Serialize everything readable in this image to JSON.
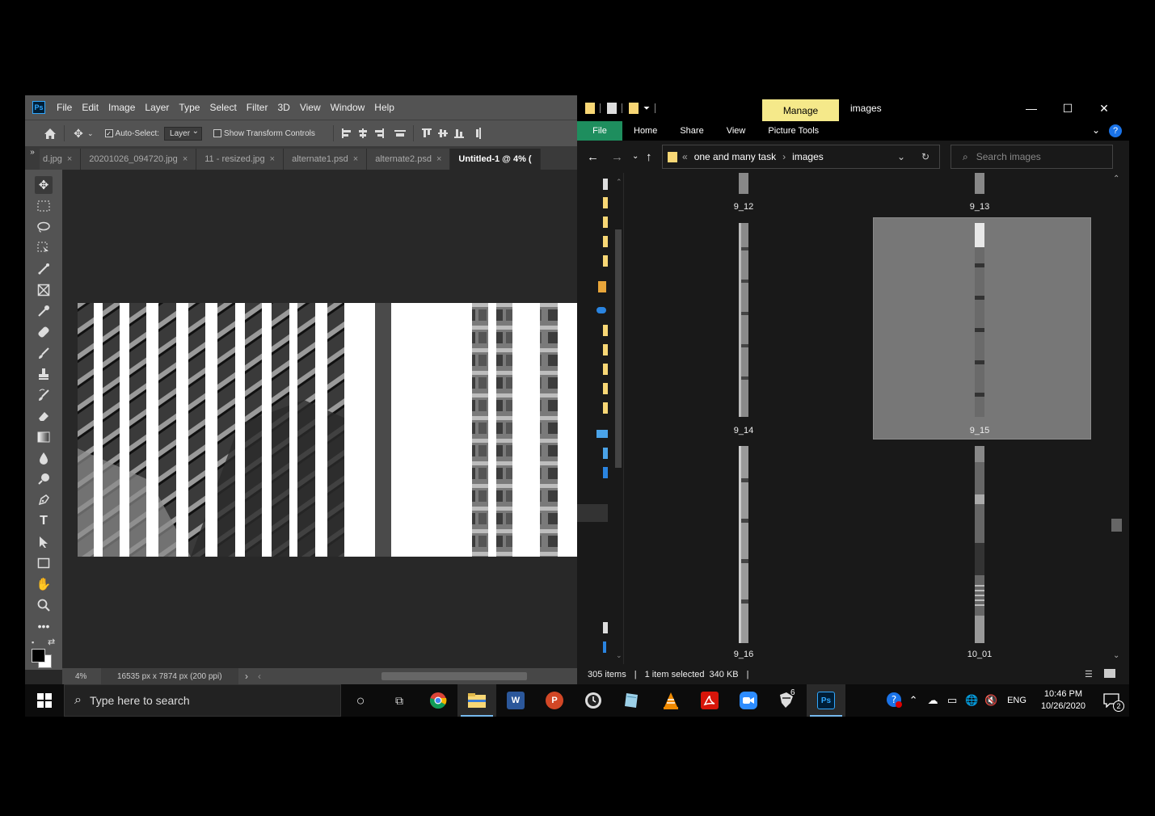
{
  "photoshop": {
    "logo": "Ps",
    "menu": [
      "File",
      "Edit",
      "Image",
      "Layer",
      "Type",
      "Select",
      "Filter",
      "3D",
      "View",
      "Window",
      "Help"
    ],
    "options": {
      "auto_select_label": "Auto-Select:",
      "layer_select": "Layer",
      "show_transform_label": "Show Transform Controls"
    },
    "tabs_overflow": "»",
    "tabs": [
      {
        "label": "d.jpg",
        "close": "×"
      },
      {
        "label": "20201026_094720.jpg",
        "close": "×"
      },
      {
        "label": "11 - resized.jpg",
        "close": "×"
      },
      {
        "label": "alternate1.psd",
        "close": "×"
      },
      {
        "label": "alternate2.psd",
        "close": "×"
      },
      {
        "label": "Untitled-1 @ 4% (",
        "close": ""
      }
    ],
    "status": {
      "zoom": "4%",
      "dimensions": "16535 px x 7874 px (200 ppi)",
      "arrow": "›",
      "left_arrow": "‹"
    },
    "tool_icons": [
      "move-tool-icon",
      "marquee-tool-icon",
      "lasso-tool-icon",
      "object-select-icon",
      "crop-tool-icon",
      "frame-tool-icon",
      "eyedropper-icon",
      "healing-brush-icon",
      "brush-icon",
      "clone-stamp-icon",
      "history-brush-icon",
      "eraser-icon",
      "gradient-icon",
      "blur-icon",
      "dodge-icon",
      "pen-icon",
      "type-icon",
      "path-select-icon",
      "rectangle-icon",
      "hand-icon",
      "zoom-icon",
      "more-tools-icon"
    ],
    "type_tool_glyph": "T"
  },
  "explorer": {
    "ribbon_context": "Manage",
    "window_title": "images",
    "window_controls": {
      "minimize": "—",
      "maximize": "☐",
      "close": "✕"
    },
    "ribbon_tabs": [
      "File",
      "Home",
      "Share",
      "View",
      "Picture Tools"
    ],
    "help": "?",
    "address": {
      "chevrons": "«",
      "crumbs": [
        "one and many task",
        "images"
      ],
      "separator": "›"
    },
    "search_placeholder": "Search images",
    "thumbnails": [
      {
        "label": "9_12"
      },
      {
        "label": "9_13"
      },
      {
        "label": "9_14"
      },
      {
        "label": "9_15",
        "selected": true
      },
      {
        "label": "9_16"
      },
      {
        "label": "10_01"
      }
    ],
    "status": {
      "items": "305 items",
      "selected": "1 item selected",
      "size": "340 KB",
      "divider": "|"
    }
  },
  "taskbar": {
    "search_placeholder": "Type here to search",
    "apps": [
      {
        "name": "cortana",
        "glyph": "○"
      },
      {
        "name": "task-view",
        "glyph": "⧉"
      },
      {
        "name": "chrome",
        "glyph": ""
      },
      {
        "name": "file-explorer",
        "glyph": ""
      },
      {
        "name": "word",
        "glyph": "W"
      },
      {
        "name": "powerpoint",
        "glyph": "P"
      },
      {
        "name": "clock-app",
        "glyph": ""
      },
      {
        "name": "notes-app",
        "glyph": ""
      },
      {
        "name": "vlc",
        "glyph": ""
      },
      {
        "name": "acrobat",
        "glyph": ""
      },
      {
        "name": "zoom",
        "glyph": ""
      },
      {
        "name": "inkscape",
        "glyph": "6"
      },
      {
        "name": "photoshop",
        "glyph": "Ps"
      }
    ],
    "tray": {
      "lang": "ENG",
      "time": "10:46 PM",
      "date": "10/26/2020",
      "notifications": "2"
    }
  }
}
